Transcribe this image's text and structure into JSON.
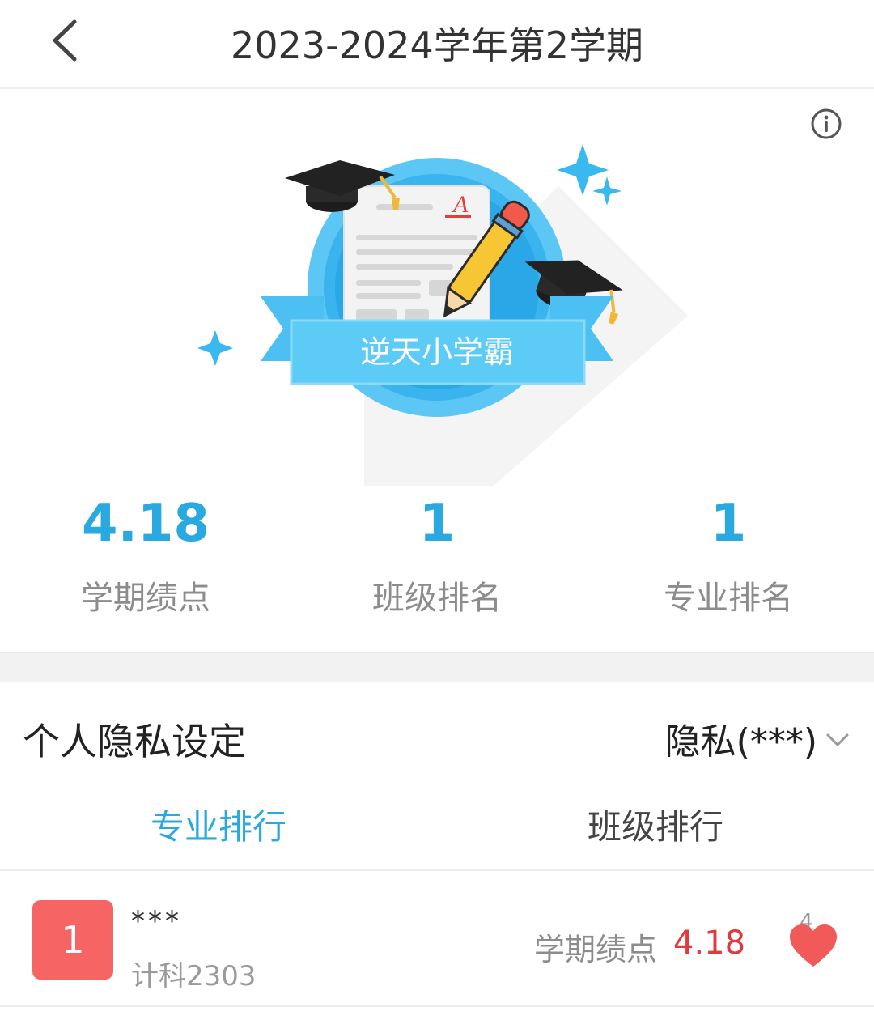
{
  "header": {
    "title": "2023-2024学年第2学期",
    "back_icon": "chevron-left-icon"
  },
  "badge": {
    "title": "逆天小学霸",
    "paper_grade": "A",
    "accent_color": "#3ab8f0"
  },
  "stats": [
    {
      "value": "4.18",
      "label": "学期绩点"
    },
    {
      "value": "1",
      "label": "班级排名"
    },
    {
      "value": "1",
      "label": "专业排名"
    }
  ],
  "privacy": {
    "label": "个人隐私设定",
    "value": "隐私(***)"
  },
  "tabs": [
    {
      "label": "专业排行",
      "active": true
    },
    {
      "label": "班级排行",
      "active": false
    }
  ],
  "ranking": [
    {
      "rank": "1",
      "name": "***",
      "class": "计科2303",
      "gpa_label": "学期绩点",
      "gpa": "4.18",
      "likes": "4"
    }
  ],
  "colors": {
    "primary": "#2aa8e0",
    "rank_badge": "#f76464",
    "gpa_value": "#e0393e",
    "heart": "#f25a5a"
  }
}
